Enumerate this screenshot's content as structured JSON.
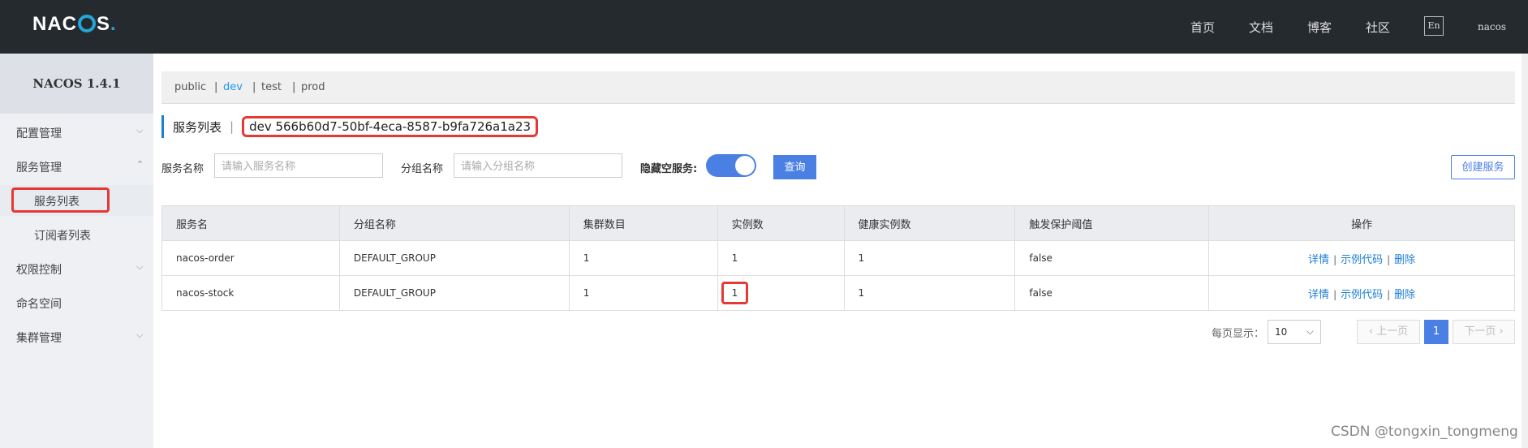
{
  "header": {
    "logo_letters": [
      "NAC",
      "S",
      "."
    ],
    "nav": [
      "首页",
      "文档",
      "博客",
      "社区"
    ],
    "lang": "En",
    "user": "nacos"
  },
  "sidebar": {
    "title": "NACOS 1.4.1",
    "items": [
      {
        "label": "配置管理",
        "chevron": "⌵"
      },
      {
        "label": "服务管理",
        "chevron": "⌃"
      },
      {
        "label": "服务列表",
        "sub": true,
        "active": true
      },
      {
        "label": "订阅者列表",
        "sub": true
      },
      {
        "label": "权限控制",
        "chevron": "⌵"
      },
      {
        "label": "命名空间"
      },
      {
        "label": "集群管理",
        "chevron": "⌵"
      }
    ]
  },
  "namespaces": [
    "public",
    "|",
    "dev",
    "|",
    "test",
    "|",
    "prod"
  ],
  "page": {
    "title": "服务列表",
    "separator": "|",
    "namespace_id": "dev  566b60d7-50bf-4eca-8587-b9fa726a1a23"
  },
  "filters": {
    "service_name_label": "服务名称",
    "service_name_placeholder": "请输入服务名称",
    "group_name_label": "分组名称",
    "group_name_placeholder": "请输入分组名称",
    "hide_empty_label": "隐藏空服务:",
    "hide_empty_enabled": true,
    "query_button": "查询",
    "create_button": "创建服务"
  },
  "table": {
    "columns": [
      "服务名",
      "分组名称",
      "集群数目",
      "实例数",
      "健康实例数",
      "触发保护阈值",
      "操作"
    ],
    "rows": [
      {
        "name": "nacos-order",
        "group": "DEFAULT_GROUP",
        "clusters": "1",
        "instances": "1",
        "healthy": "1",
        "protect": "false"
      },
      {
        "name": "nacos-stock",
        "group": "DEFAULT_GROUP",
        "clusters": "1",
        "instances": "1",
        "healthy": "1",
        "protect": "false"
      }
    ],
    "actions": {
      "detail": "详情",
      "sample": "示例代码",
      "delete": "删除",
      "sep": "|"
    }
  },
  "pagination": {
    "page_size_label": "每页显示：",
    "page_size": "10",
    "prev": "上一页",
    "current": "1",
    "next": "下一页"
  },
  "watermark": "CSDN @tongxin_tongmeng",
  "colors": {
    "accent": "#4a7fe3",
    "highlight": "#e53935",
    "topbar": "#252a2f",
    "link": "#1c7fd6"
  }
}
